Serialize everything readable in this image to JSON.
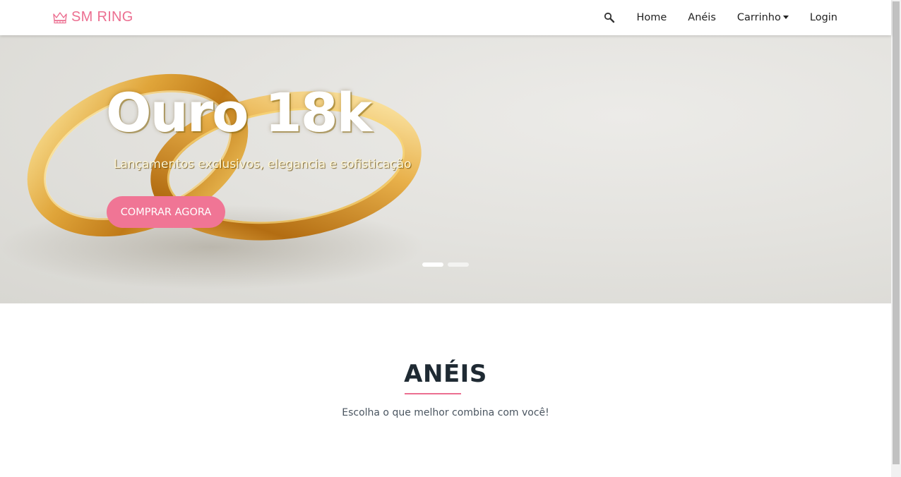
{
  "navbar": {
    "brand": "SM RING",
    "brand_icon": "crown-icon",
    "search_icon": "search-icon",
    "links": [
      "Home",
      "Anéis",
      "Carrinho",
      "Login"
    ],
    "accent": "#ec6f91"
  },
  "hero": {
    "title": "Ouro 18k",
    "subtitle": "Lançamentos exclusivos, elegancia e sofisticação",
    "button": "COMPRAR AGORA",
    "button_color": "#f07595",
    "slides_total": 2,
    "slide_active": 1
  },
  "section": {
    "title": "ANÉIS",
    "subtitle": "Escolha o que melhor combina com você!"
  }
}
